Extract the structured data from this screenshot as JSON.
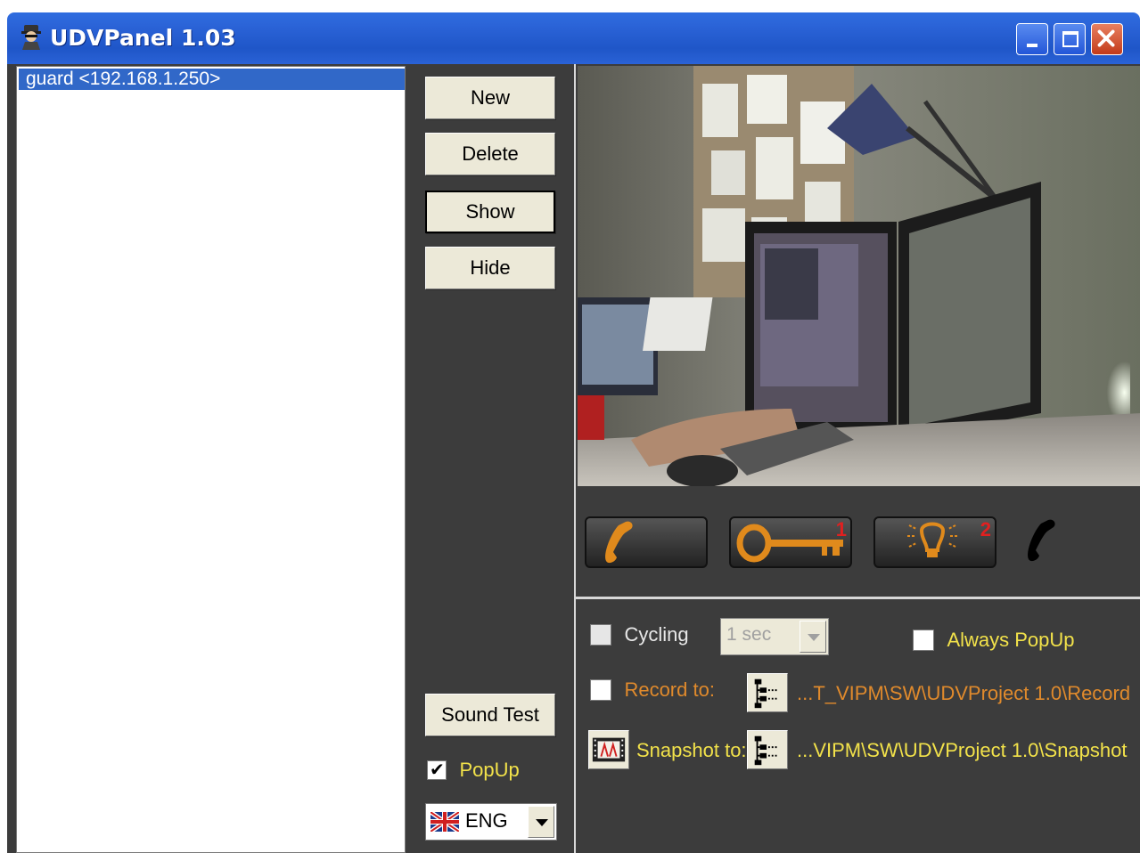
{
  "window": {
    "title": "UDVPanel 1.03"
  },
  "devices": [
    {
      "label": "guard <192.168.1.250>"
    }
  ],
  "buttons": {
    "new": "New",
    "delete": "Delete",
    "show": "Show",
    "hide": "Hide",
    "sound_test": "Sound Test"
  },
  "popup": {
    "label": "PopUp",
    "checked": true
  },
  "language": {
    "value": "ENG"
  },
  "controls": {
    "key_badge": "1",
    "light_badge": "2"
  },
  "options": {
    "cycling_label": "Cycling",
    "cycling_interval": "1 sec",
    "always_popup_label": "Always PopUp",
    "record_label": "Record to:",
    "record_path": "...T_VIPM\\SW\\UDVProject 1.0\\Record",
    "snapshot_label": "Snapshot to:",
    "snapshot_path": "...VIPM\\SW\\UDVProject 1.0\\Snapshot"
  },
  "colors": {
    "title_bar": "#2a62d6",
    "panel_bg": "#3c3c3c",
    "selection": "#3168c8",
    "accent_yellow": "#f2e24a",
    "accent_orange": "#e08a2c"
  }
}
